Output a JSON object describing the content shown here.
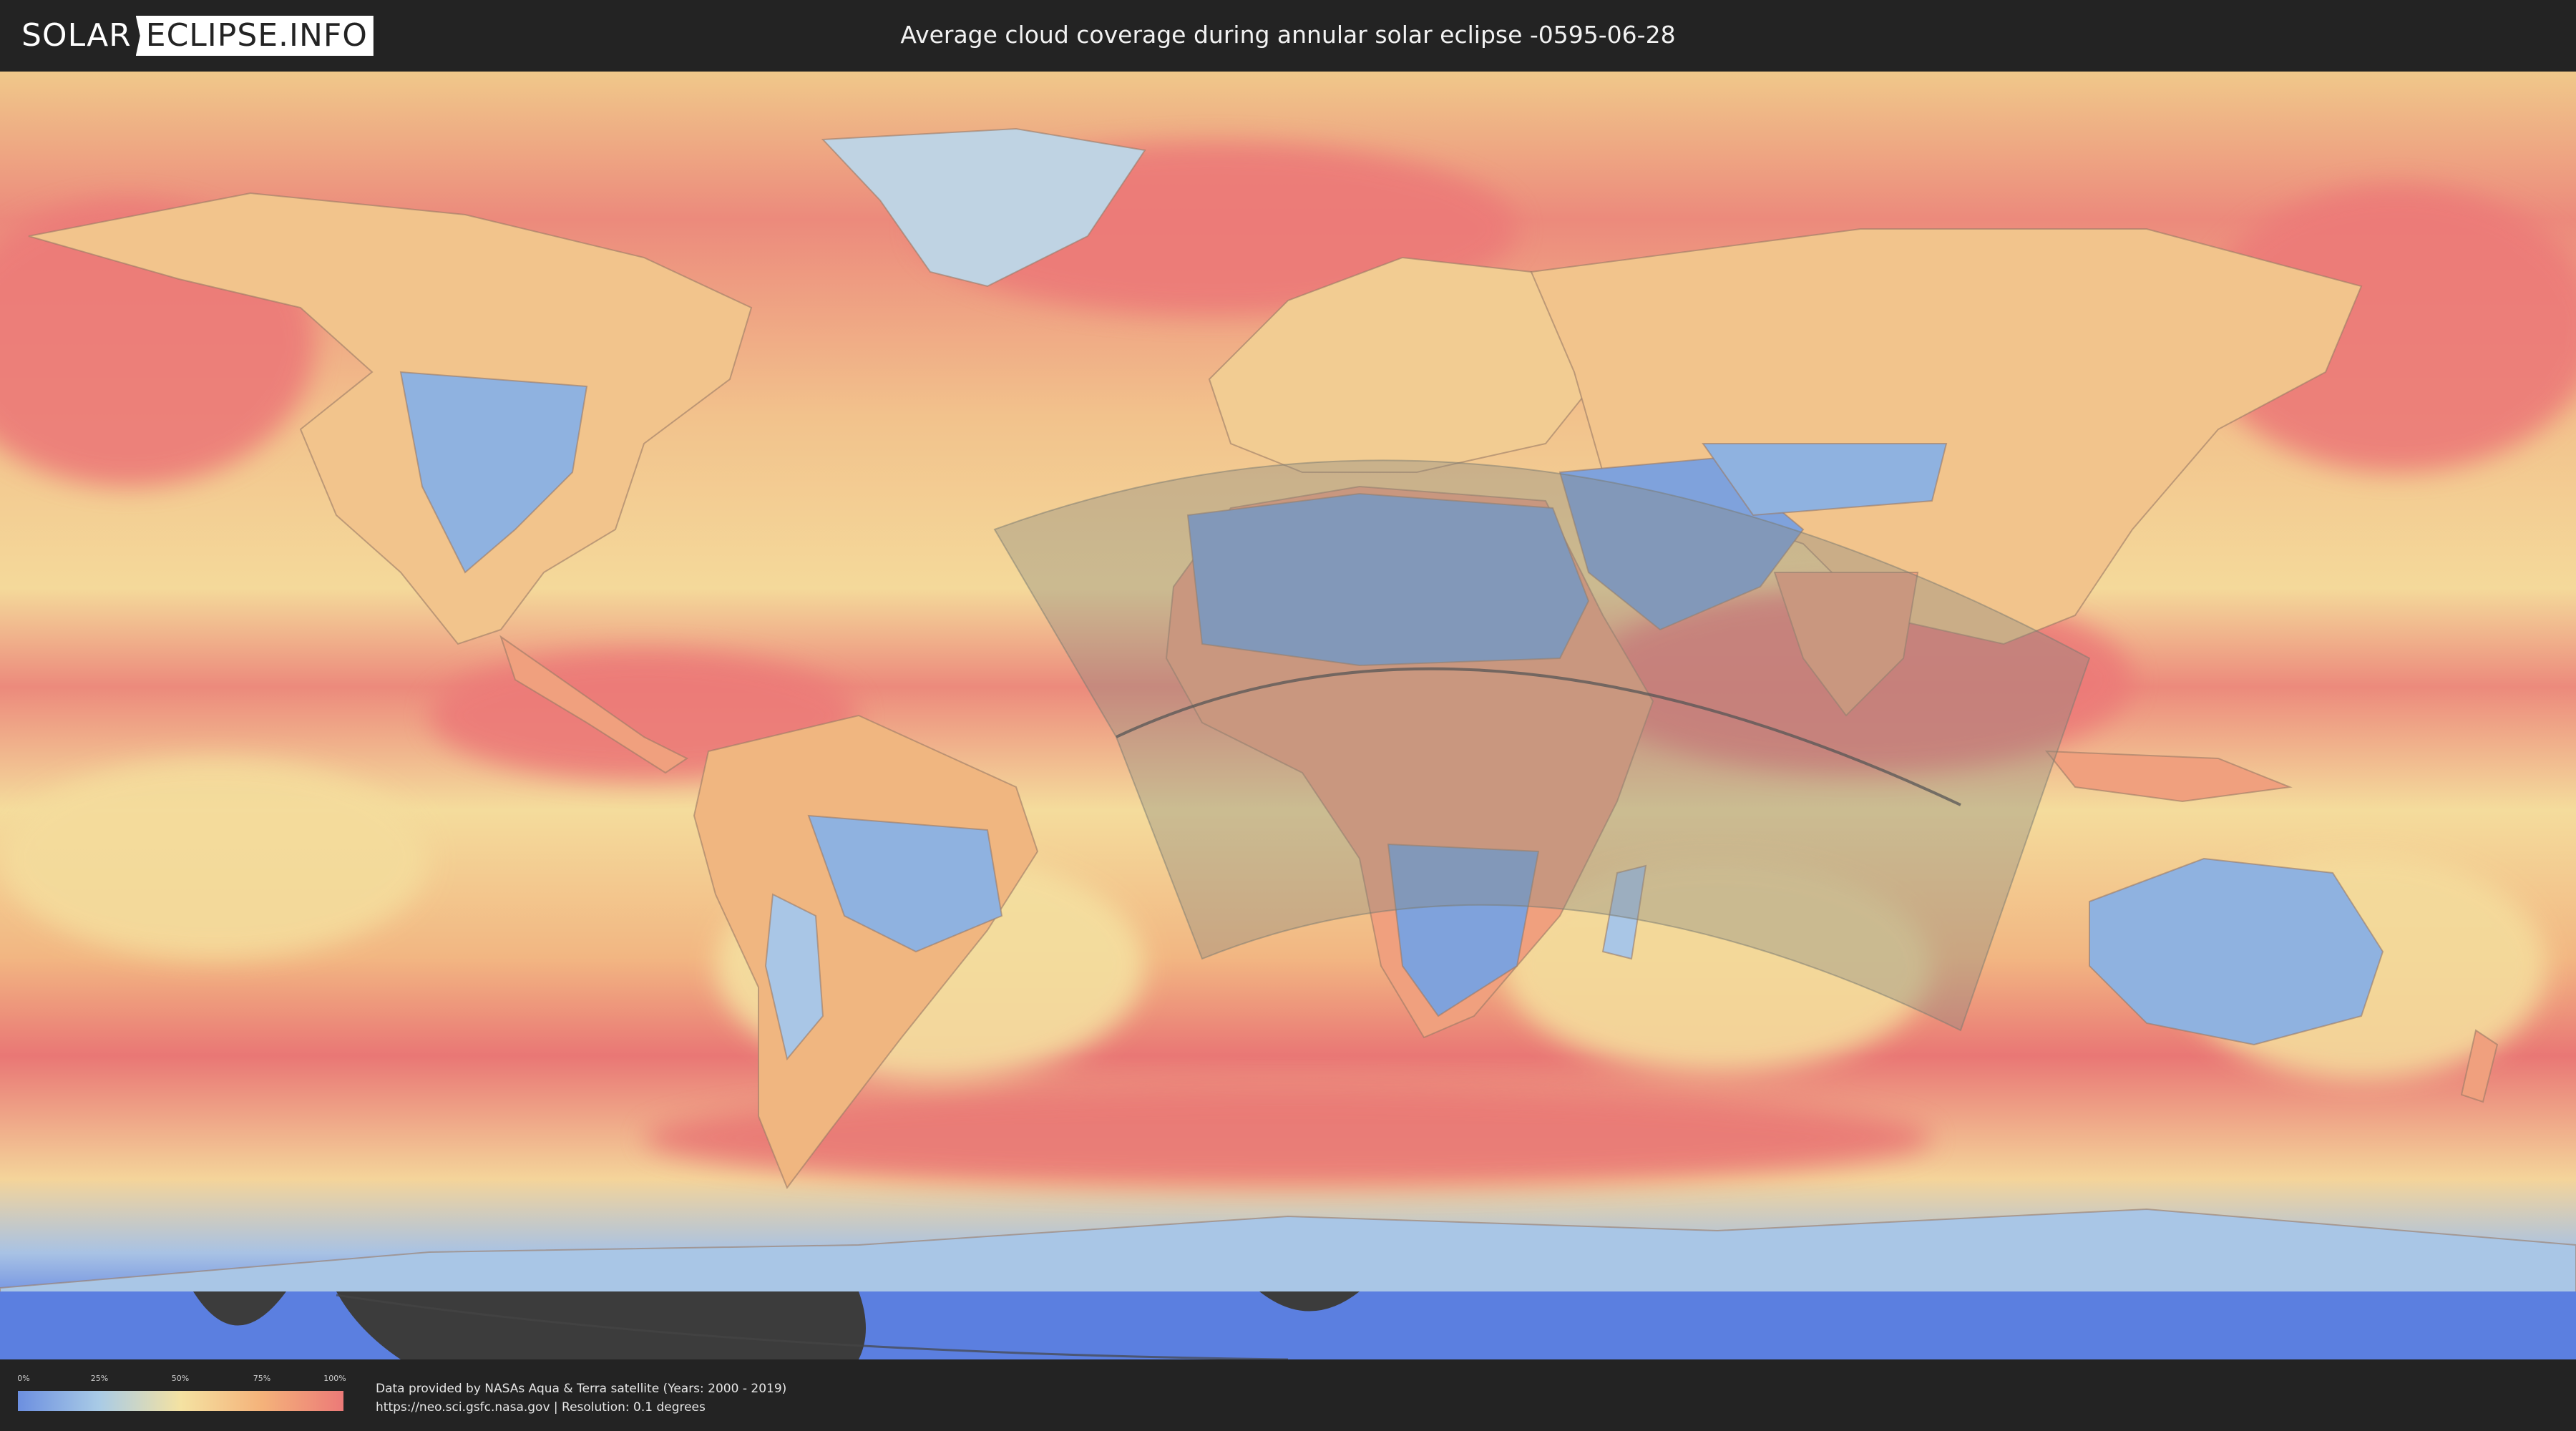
{
  "header": {
    "logo_part1": "SOLAR",
    "logo_part2": "ECLIPSE.INFO",
    "title": "Average cloud coverage during annular solar eclipse -0595-06-28"
  },
  "legend": {
    "ticks": [
      "0%",
      "25%",
      "50%",
      "75%",
      "100%"
    ],
    "colors": [
      "#6c8fe0",
      "#a9cbe6",
      "#f4e2a2",
      "#f4b27a",
      "#ec7a78"
    ]
  },
  "footer": {
    "credit_line1": "Data provided by NASAs Aqua & Terra satellite (Years: 2000 - 2019)",
    "credit_line2": "https://neo.sci.gsfc.nasa.gov | Resolution: 0.1 degrees"
  },
  "map": {
    "ocean_cloud_color": "#ec7e78",
    "mid_color": "#f4d99a",
    "clear_land_color": "#7fa2dc",
    "polar_color": "#5b7fe0",
    "overlay_color": "#8a8a80"
  }
}
